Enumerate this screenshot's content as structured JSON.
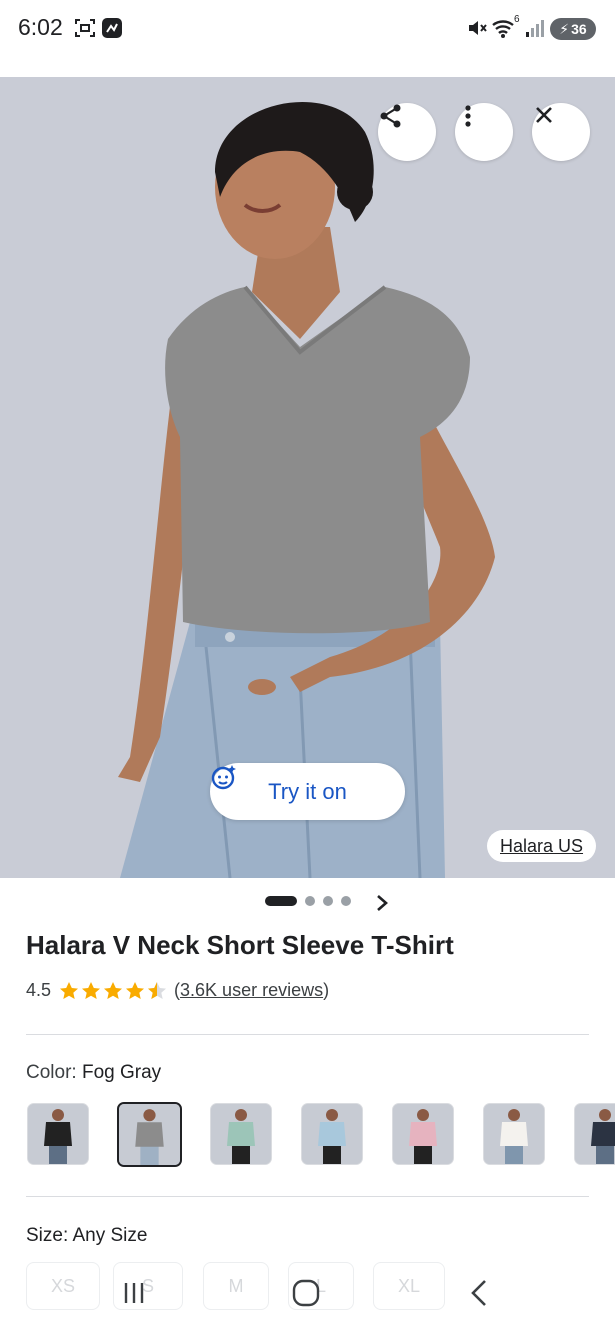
{
  "status_bar": {
    "time": "6:02",
    "battery": "36",
    "icons": [
      "screenshot-icon",
      "app-notification-icon",
      "mute-icon",
      "wifi-icon",
      "signal-icon",
      "battery-charging-icon"
    ],
    "wifi_badge": "6"
  },
  "hero": {
    "actions": [
      "share-icon",
      "more-vert-icon",
      "close-icon"
    ],
    "try_on_label": "Try it on",
    "source": "Halara US",
    "background_color": "#c9ccd6",
    "shirt_color": "#8c8c8c"
  },
  "pager": {
    "count": 4,
    "active_index": 0
  },
  "product": {
    "title": "Halara V Neck Short Sleeve T-Shirt",
    "rating": "4.5",
    "rating_value": 4.5,
    "reviews_open": "(",
    "reviews_label": "3.6K user reviews",
    "reviews_close": ")",
    "star_color": "#f9ab00"
  },
  "color": {
    "label": "Color: ",
    "value": "Fog Gray",
    "swatches": [
      {
        "name": "Black",
        "shirt": "#222222",
        "pants": "#5d6f85",
        "selected": false
      },
      {
        "name": "Fog Gray",
        "shirt": "#8c8c8c",
        "pants": "#9fb1c4",
        "selected": true
      },
      {
        "name": "Sage",
        "shirt": "#9cc5b8",
        "pants": "#222222",
        "selected": false
      },
      {
        "name": "Light Blue",
        "shirt": "#a8c8dc",
        "pants": "#222222",
        "selected": false
      },
      {
        "name": "Pink",
        "shirt": "#e6b3bf",
        "pants": "#222222",
        "selected": false
      },
      {
        "name": "White",
        "shirt": "#f4f2ee",
        "pants": "#7f96ad",
        "selected": false
      },
      {
        "name": "Navy",
        "shirt": "#2b3342",
        "pants": "#5d6f85",
        "selected": false
      }
    ]
  },
  "size": {
    "label": "Size: ",
    "value": "Any Size",
    "options": [
      "XS",
      "S",
      "M",
      "L",
      "XL"
    ]
  },
  "nav": [
    "recents-icon",
    "home-icon",
    "back-icon"
  ]
}
